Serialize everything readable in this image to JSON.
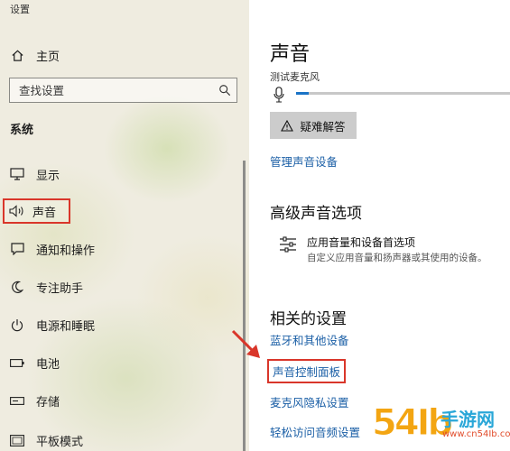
{
  "window": {
    "title": "设置"
  },
  "nav": {
    "home_label": "主页",
    "search_placeholder": "查找设置",
    "section_label": "系统",
    "items": [
      {
        "label": "显示",
        "icon": "monitor-icon"
      },
      {
        "label": "声音",
        "icon": "speaker-icon",
        "selected": true
      },
      {
        "label": "通知和操作",
        "icon": "notification-icon"
      },
      {
        "label": "专注助手",
        "icon": "moon-icon"
      },
      {
        "label": "电源和睡眠",
        "icon": "power-icon"
      },
      {
        "label": "电池",
        "icon": "battery-icon"
      },
      {
        "label": "存储",
        "icon": "storage-icon"
      },
      {
        "label": "平板模式",
        "icon": "tablet-icon"
      }
    ]
  },
  "main": {
    "title": "声音",
    "mic": {
      "label": "测试麦克风",
      "level": 0.06
    },
    "troubleshoot_label": "疑难解答",
    "manage_devices_link": "管理声音设备",
    "advanced": {
      "heading": "高级声音选项",
      "item_title": "应用音量和设备首选项",
      "item_desc": "自定义应用音量和扬声器或其使用的设备。"
    },
    "related": {
      "heading": "相关的设置",
      "links": [
        "蓝牙和其他设备",
        "声音控制面板",
        "麦克风隐私设置",
        "轻松访问音频设置"
      ]
    }
  },
  "watermark": {
    "logo": "54Ib",
    "name": "手游网",
    "url": "www.cn54Ib.com"
  },
  "colors": {
    "accent_link": "#1b5fa6",
    "highlight_box": "#d9362a",
    "meter_fill": "#1a73c6",
    "nav_bg": "#efece0"
  }
}
